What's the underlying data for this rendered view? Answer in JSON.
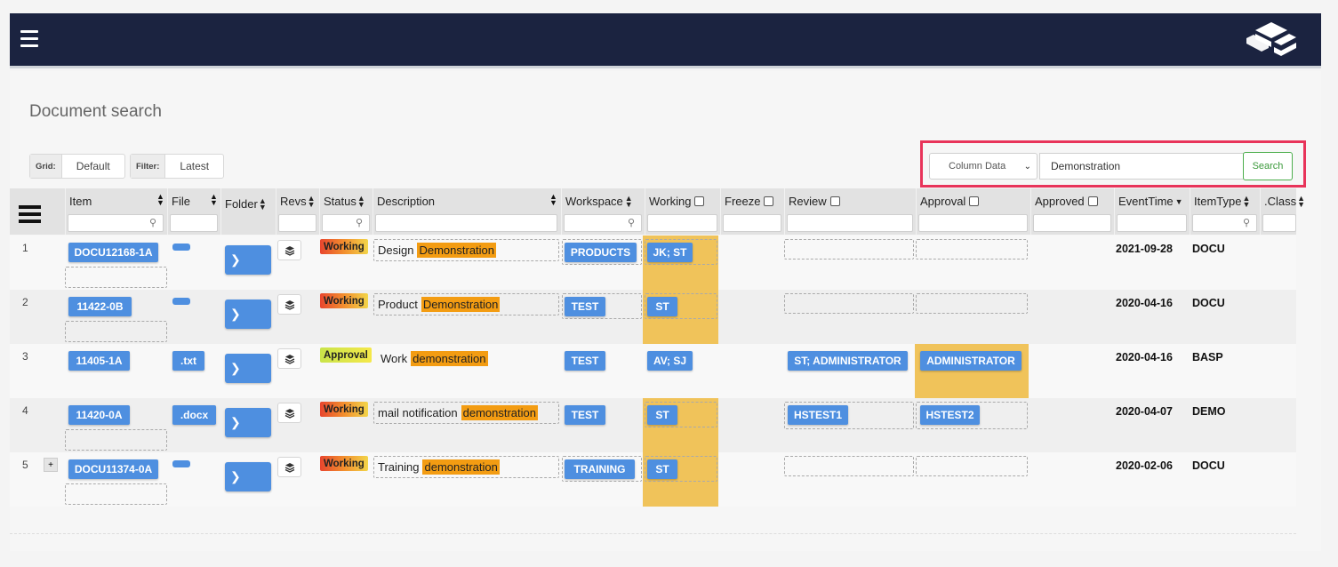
{
  "header": {
    "menu_icon": "hamburger-icon",
    "logo_icon": "cube-logo-icon"
  },
  "page": {
    "title": "Document search"
  },
  "grid": {
    "label": "Grid:",
    "value": "Default"
  },
  "filter": {
    "label": "Filter:",
    "value": "Latest"
  },
  "search": {
    "column_select": "Column Data",
    "query": "Demonstration",
    "button_label": "Search",
    "highlight_color": "#e8345a"
  },
  "columns": {
    "item": "Item",
    "file": "File",
    "folder": "Folder",
    "revs": "Revs",
    "status": "Status",
    "description": "Description",
    "workspace": "Workspace",
    "working": "Working",
    "freeze": "Freeze",
    "review": "Review",
    "approval": "Approval",
    "approved": "Approved",
    "eventtime": "EventTime",
    "itemtype": "ItemType",
    "class": ".Class"
  },
  "colors": {
    "accent_blue": "#4e8fe0",
    "highlight_orange": "#f39c12",
    "cell_yellow": "#f0c35a",
    "topbar": "#1b2340"
  },
  "rows": [
    {
      "num": "1",
      "item": "DOCU12168-1A",
      "file": "",
      "status": "Working",
      "desc_prefix": "Design",
      "desc_match": "Demonstration",
      "workspace": "PRODUCTS",
      "working": "JK; ST",
      "review": "",
      "approval": "",
      "eventtime": "2021-09-28",
      "itemtype": "DOCU"
    },
    {
      "num": "2",
      "item": "11422-0B",
      "file": "",
      "status": "Working",
      "desc_prefix": "Product",
      "desc_match": "Demonstration",
      "workspace": "TEST",
      "working": "ST",
      "review": "",
      "approval": "",
      "eventtime": "2020-04-16",
      "itemtype": "DOCU"
    },
    {
      "num": "3",
      "item": "11405-1A",
      "file": ".txt",
      "status": "Approval",
      "desc_prefix": "Work",
      "desc_match": "demonstration",
      "workspace": "TEST",
      "working": "AV; SJ",
      "review": "ST; ADMINISTRATOR",
      "approval": "ADMINISTRATOR",
      "eventtime": "2020-04-16",
      "itemtype": "BASP"
    },
    {
      "num": "4",
      "item": "11420-0A",
      "file": ".docx",
      "status": "Working",
      "desc_prefix": "mail notification",
      "desc_match": "demonstration",
      "workspace": "TEST",
      "working": "ST",
      "review": "HSTEST1",
      "approval": "HSTEST2",
      "eventtime": "2020-04-07",
      "itemtype": "DEMO"
    },
    {
      "num": "5",
      "item": "DOCU11374-0A",
      "file": "",
      "status": "Working",
      "desc_prefix": "Training",
      "desc_match": "demonstration",
      "workspace": "TRAINING",
      "working": "ST",
      "review": "",
      "approval": "",
      "eventtime": "2020-02-06",
      "itemtype": "DOCU",
      "expand": "+"
    }
  ]
}
